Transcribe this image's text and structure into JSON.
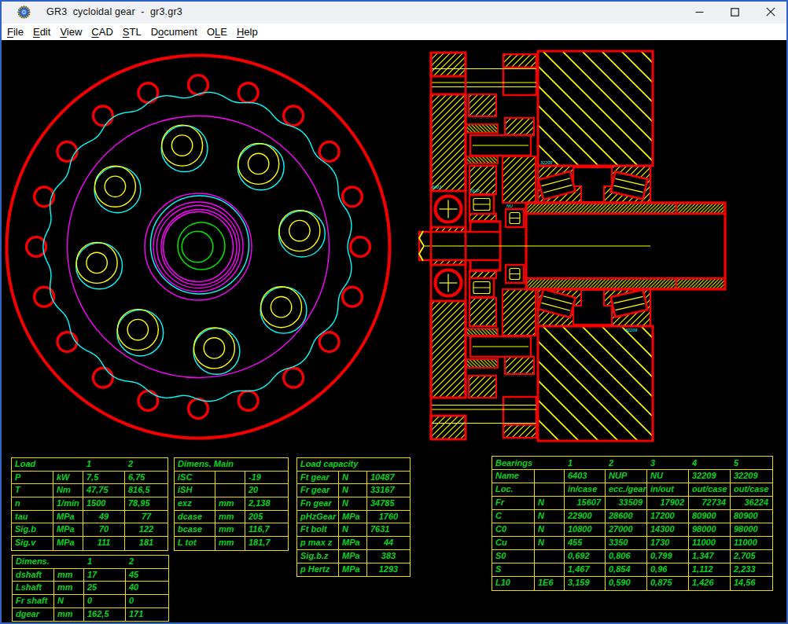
{
  "window": {
    "title": "GR3  cycloidal gear  -  gr3.gr3",
    "buttons": {
      "minimize": "minimize",
      "maximize": "maximize",
      "close": "close"
    }
  },
  "menu": {
    "items": [
      {
        "pre": "",
        "acc": "F",
        "post": "ile"
      },
      {
        "pre": "",
        "acc": "E",
        "post": "dit"
      },
      {
        "pre": "",
        "acc": "V",
        "post": "iew"
      },
      {
        "pre": "",
        "acc": "C",
        "post": "AD"
      },
      {
        "pre": "",
        "acc": "S",
        "post": "TL"
      },
      {
        "pre": "D",
        "acc": "o",
        "post": "cument"
      },
      {
        "pre": "O",
        "acc": "L",
        "post": "E"
      },
      {
        "pre": "",
        "acc": "H",
        "post": "elp"
      }
    ]
  },
  "drawing_labels": {
    "bearing_left": "6403",
    "bearing_mid1": "NUP",
    "bearing_mid2": "NU",
    "bearing_top": "32209",
    "bearing_bottom": "32209"
  },
  "colors": {
    "drawing_red": "#f40000",
    "drawing_yellow": "#ffff00",
    "drawing_cyan": "#00ffff",
    "drawing_magenta": "#ff00ff",
    "drawing_green": "#00e000",
    "table_text_green": "#00d221",
    "table_border_yellow": "#eadb00",
    "window_border_blue": "#3263c3",
    "titlebar_bg": "#f0f1f4",
    "canvas_bg": "#000000"
  },
  "tables": [
    {
      "id": "load",
      "title": "Load",
      "header_nums": [
        "1",
        "2"
      ],
      "rows": [
        [
          "P",
          "kW",
          "7,5",
          "6,75"
        ],
        [
          "T",
          "Nm",
          "47,75",
          "816,5"
        ],
        [
          "n",
          "1/min",
          "1500",
          "78,95"
        ],
        [
          "tau",
          "MPa",
          "49",
          "77"
        ],
        [
          "Sig.b",
          "MPa",
          "70",
          "122"
        ],
        [
          "Sig.v",
          "MPa",
          "111",
          "181"
        ]
      ],
      "aligns": [
        "llll",
        "llll",
        "llll",
        "llcc",
        "llcc",
        "llcc"
      ]
    },
    {
      "id": "dimens",
      "title": "Dimens.",
      "header_nums": [
        "1",
        "2"
      ],
      "rows": [
        [
          "dshaft",
          "mm",
          "17",
          "45"
        ],
        [
          "Lshaft",
          "mm",
          "25",
          "40"
        ],
        [
          "Fr shaft",
          "N",
          "0",
          "0"
        ],
        [
          "dgear",
          "mm",
          "162,5",
          "171"
        ]
      ],
      "aligns": [
        "llll",
        "llll",
        "llll",
        "llll"
      ]
    },
    {
      "id": "dimens-main",
      "title": "Dimens. Main",
      "header_nums": [],
      "rows": [
        [
          "iSC",
          "",
          "-19"
        ],
        [
          "iSH",
          "",
          "20"
        ],
        [
          "exz",
          "mm",
          "2,138"
        ],
        [
          "dcase",
          "mm",
          "205"
        ],
        [
          "bcase",
          "mm",
          "116,7"
        ],
        [
          "L tot",
          "mm",
          "181,7"
        ]
      ],
      "aligns": [
        "lll",
        "lll",
        "lll",
        "lll",
        "lll",
        "lll"
      ]
    },
    {
      "id": "load-capacity",
      "title": "Load capacity",
      "header_nums": [],
      "rows": [
        [
          "Ft gear",
          "N",
          "10487"
        ],
        [
          "Fr gear",
          "N",
          "33167"
        ],
        [
          "Fn gear",
          "N",
          "34785"
        ],
        [
          "pHzGear",
          "MPa",
          "1760"
        ],
        [
          "Ft bolt",
          "N",
          "7631"
        ],
        [
          "p max z",
          "MPa",
          "44"
        ],
        [
          "Sig.b.z",
          "MPa",
          "383"
        ],
        [
          "p Hertz",
          "MPa",
          "1293"
        ]
      ],
      "aligns": [
        "lll",
        "lll",
        "lll",
        "llc",
        "lll",
        "llc",
        "llc",
        "llc"
      ]
    },
    {
      "id": "bearings",
      "title": "Bearings",
      "header_nums": [
        "1",
        "2",
        "3",
        "4",
        "5"
      ],
      "rows": [
        [
          "Name",
          "",
          "6403",
          "NUP",
          "NU",
          "32209",
          "32209"
        ],
        [
          "Loc.",
          "",
          "in/case",
          "ecc./gear",
          "in/out",
          "out/case",
          "out/case"
        ],
        [
          "Fr",
          "N",
          "15607",
          "33509",
          "17902",
          "72734",
          "36224"
        ],
        [
          "C",
          "N",
          "22900",
          "28600",
          "17200",
          "80900",
          "80900"
        ],
        [
          "C0",
          "N",
          "10800",
          "27000",
          "14300",
          "98000",
          "98000"
        ],
        [
          "Cu",
          "N",
          "455",
          "3350",
          "1730",
          "11000",
          "11000"
        ],
        [
          "S0",
          "",
          "0,692",
          "0,806",
          "0,799",
          "1,347",
          "2,705"
        ],
        [
          "S",
          "",
          "1,467",
          "0,854",
          "0,96",
          "1,112",
          "2,233"
        ],
        [
          "L10",
          "1E6",
          "3,159",
          "0,590",
          "0,875",
          "1,426",
          "14,56"
        ]
      ],
      "aligns": [
        "lllllll",
        "lllllll",
        "llrrrrr",
        "lllllll",
        "lllllll",
        "lllllll",
        "lllllll",
        "lllllll",
        "lllllll"
      ]
    }
  ]
}
